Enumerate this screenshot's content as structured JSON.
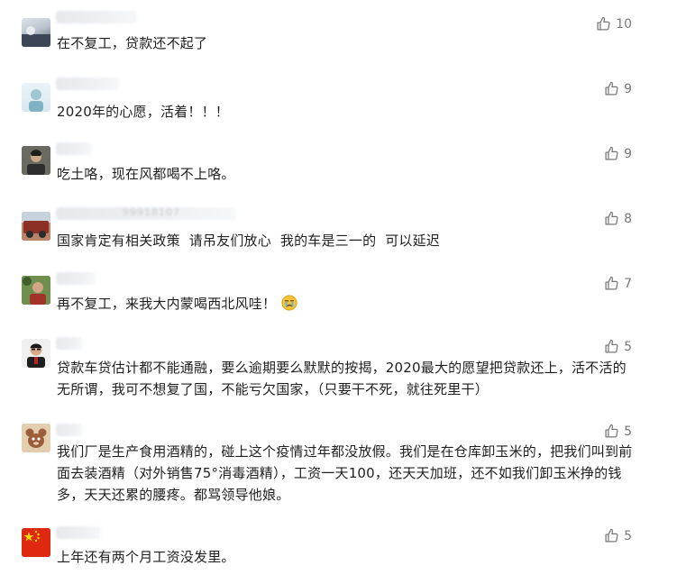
{
  "comments": [
    {
      "id": 1,
      "likes": "10",
      "text": "在不复工，贷款还不起了"
    },
    {
      "id": 2,
      "likes": "9",
      "text": "2020年的心愿，活着！！！"
    },
    {
      "id": 3,
      "likes": "9",
      "text": "吃土咯，现在风都喝不上咯。"
    },
    {
      "id": 4,
      "likes": "8",
      "name_fragment": "99918107",
      "text": "国家肯定有相关政策  请吊友们放心  我的车是三一的  可以延迟"
    },
    {
      "id": 5,
      "likes": "7",
      "text": "再不复工，来我大内蒙喝西北风哇！",
      "emoji": "crying-face-icon"
    },
    {
      "id": 6,
      "likes": "5",
      "text": "贷款车贷估计都不能通融，要么逾期要么默默的按揭，2020最大的愿望把贷款还上，活不活的无所谓，我可不想复了国，不能亏欠国家，（只要干不死，就往死里干）"
    },
    {
      "id": 7,
      "likes": "5",
      "text": "我们厂是生产食用酒精的，碰上这个疫情过年都没放假。我们是在仓库卸玉米的，把我们叫到前面去装酒精（对外销售75°消毒酒精），工资一天100，还天天加班，还不如我们卸玉米挣的钱多，天天还累的腰疼。都骂领导他娘。"
    },
    {
      "id": 8,
      "likes": "5",
      "text": "上年还有两个月工资没发里。"
    }
  ],
  "colors": {
    "text": "#1f1f1f",
    "likes": "#7a7a7a",
    "background": "#ffffff"
  }
}
